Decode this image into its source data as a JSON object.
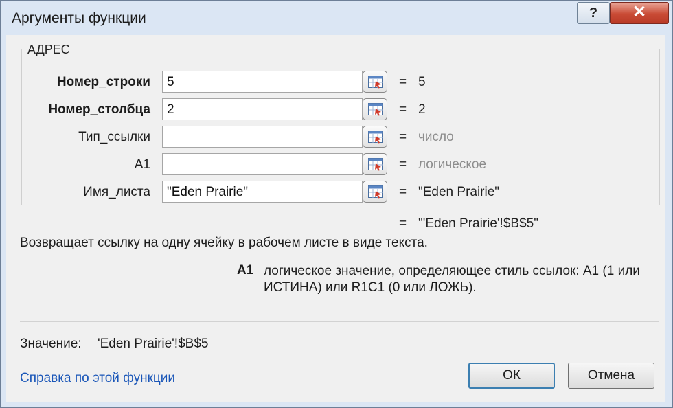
{
  "window": {
    "title": "Аргументы функции",
    "help_glyph": "?",
    "close_glyph": "✕"
  },
  "function_name": "АДРЕС",
  "arguments": [
    {
      "label": "Номер_строки",
      "value": "5",
      "result": "5",
      "required": true
    },
    {
      "label": "Номер_столбца",
      "value": "2",
      "result": "2",
      "required": true
    },
    {
      "label": "Тип_ссылки",
      "value": "",
      "result": "число",
      "required": false
    },
    {
      "label": "A1",
      "value": "",
      "result": "логическое",
      "required": false
    },
    {
      "label": "Имя_листа",
      "value": "\"Eden Prairie\"",
      "result": "\"Eden Prairie\"",
      "required": false
    }
  ],
  "equals_sign": "=",
  "formula_result": "\"'Eden Prairie'!$B$5\"",
  "function_description": "Возвращает ссылку на одну ячейку в рабочем листе в виде текста.",
  "argument_help": {
    "name": "A1",
    "text": "логическое значение, определяющее стиль ссылок: A1 (1 или ИСТИНА) или R1C1 (0 или ЛОЖЬ)."
  },
  "value_row": {
    "label": "Значение:",
    "value": "'Eden Prairie'!$B$5"
  },
  "help_link": "Справка по этой функции",
  "buttons": {
    "ok": "ОК",
    "cancel": "Отмена"
  },
  "icons": {
    "ref": "range-select-icon"
  }
}
